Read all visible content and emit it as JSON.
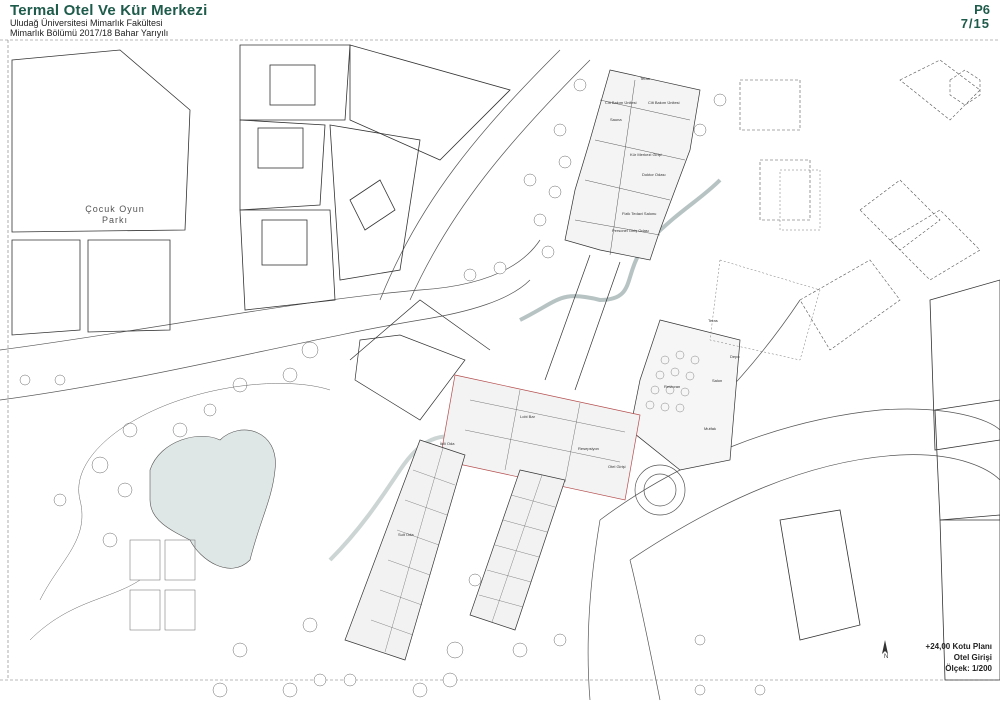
{
  "header": {
    "title": "Termal Otel Ve Kür Merkezi",
    "university": "Uludağ Üniversitesi Mimarlık Fakültesi",
    "department": "Mimarlık Bölümü 2017/18 Bahar Yarıyılı",
    "sheet_code": "P6",
    "sheet_number": "7/15"
  },
  "site": {
    "park_label_line1": "Çocuk Oyun",
    "park_label_line2": "Parkı"
  },
  "plan_info": {
    "level": "+24,00 Kotu Planı",
    "name": "Otel Girişi",
    "scale": "Ölçek: 1/200",
    "north": "N"
  },
  "room_labels": {
    "teras_top": "Teras",
    "cilt_bakim_1": "Cilt Bakım Ünitesi",
    "cilt_bakim_2": "Cilt Bakım Ünitesi",
    "sauna": "Sauna",
    "kur_merkezi_giris": "Kür Merkezi Girişi",
    "doktor": "Doktor Odası",
    "fizik_tedavi": "Fizik Tedavi Salonu",
    "personel": "Personel Giriş Odası",
    "teras_restaurant": "Teras",
    "depo": "Depo",
    "salon": "Salon",
    "restoran": "Restoran",
    "mutfak": "Mutfak",
    "lobby_bar": "Lobi Bar",
    "resepsiyon": "Resepsiyon",
    "otel_giris": "Otel Girişi",
    "ikili_oda": "İkili Oda",
    "suit_oda": "Suit Oda"
  },
  "colors": {
    "title_green": "#1f5b4a",
    "water": "#dfe6e6",
    "line": "#4a4a4a",
    "accent_red": "#b44b4b"
  }
}
